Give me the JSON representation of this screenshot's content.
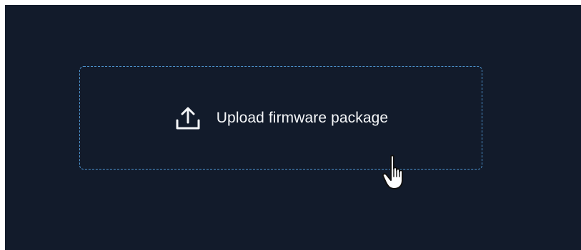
{
  "upload": {
    "label": "Upload firmware package",
    "icon": "upload-icon",
    "border_color": "#4f97d3"
  },
  "colors": {
    "panel_background": "#121b2b",
    "text": "#f4f6f8"
  },
  "cursor": {
    "icon": "hand-pointer-icon"
  }
}
